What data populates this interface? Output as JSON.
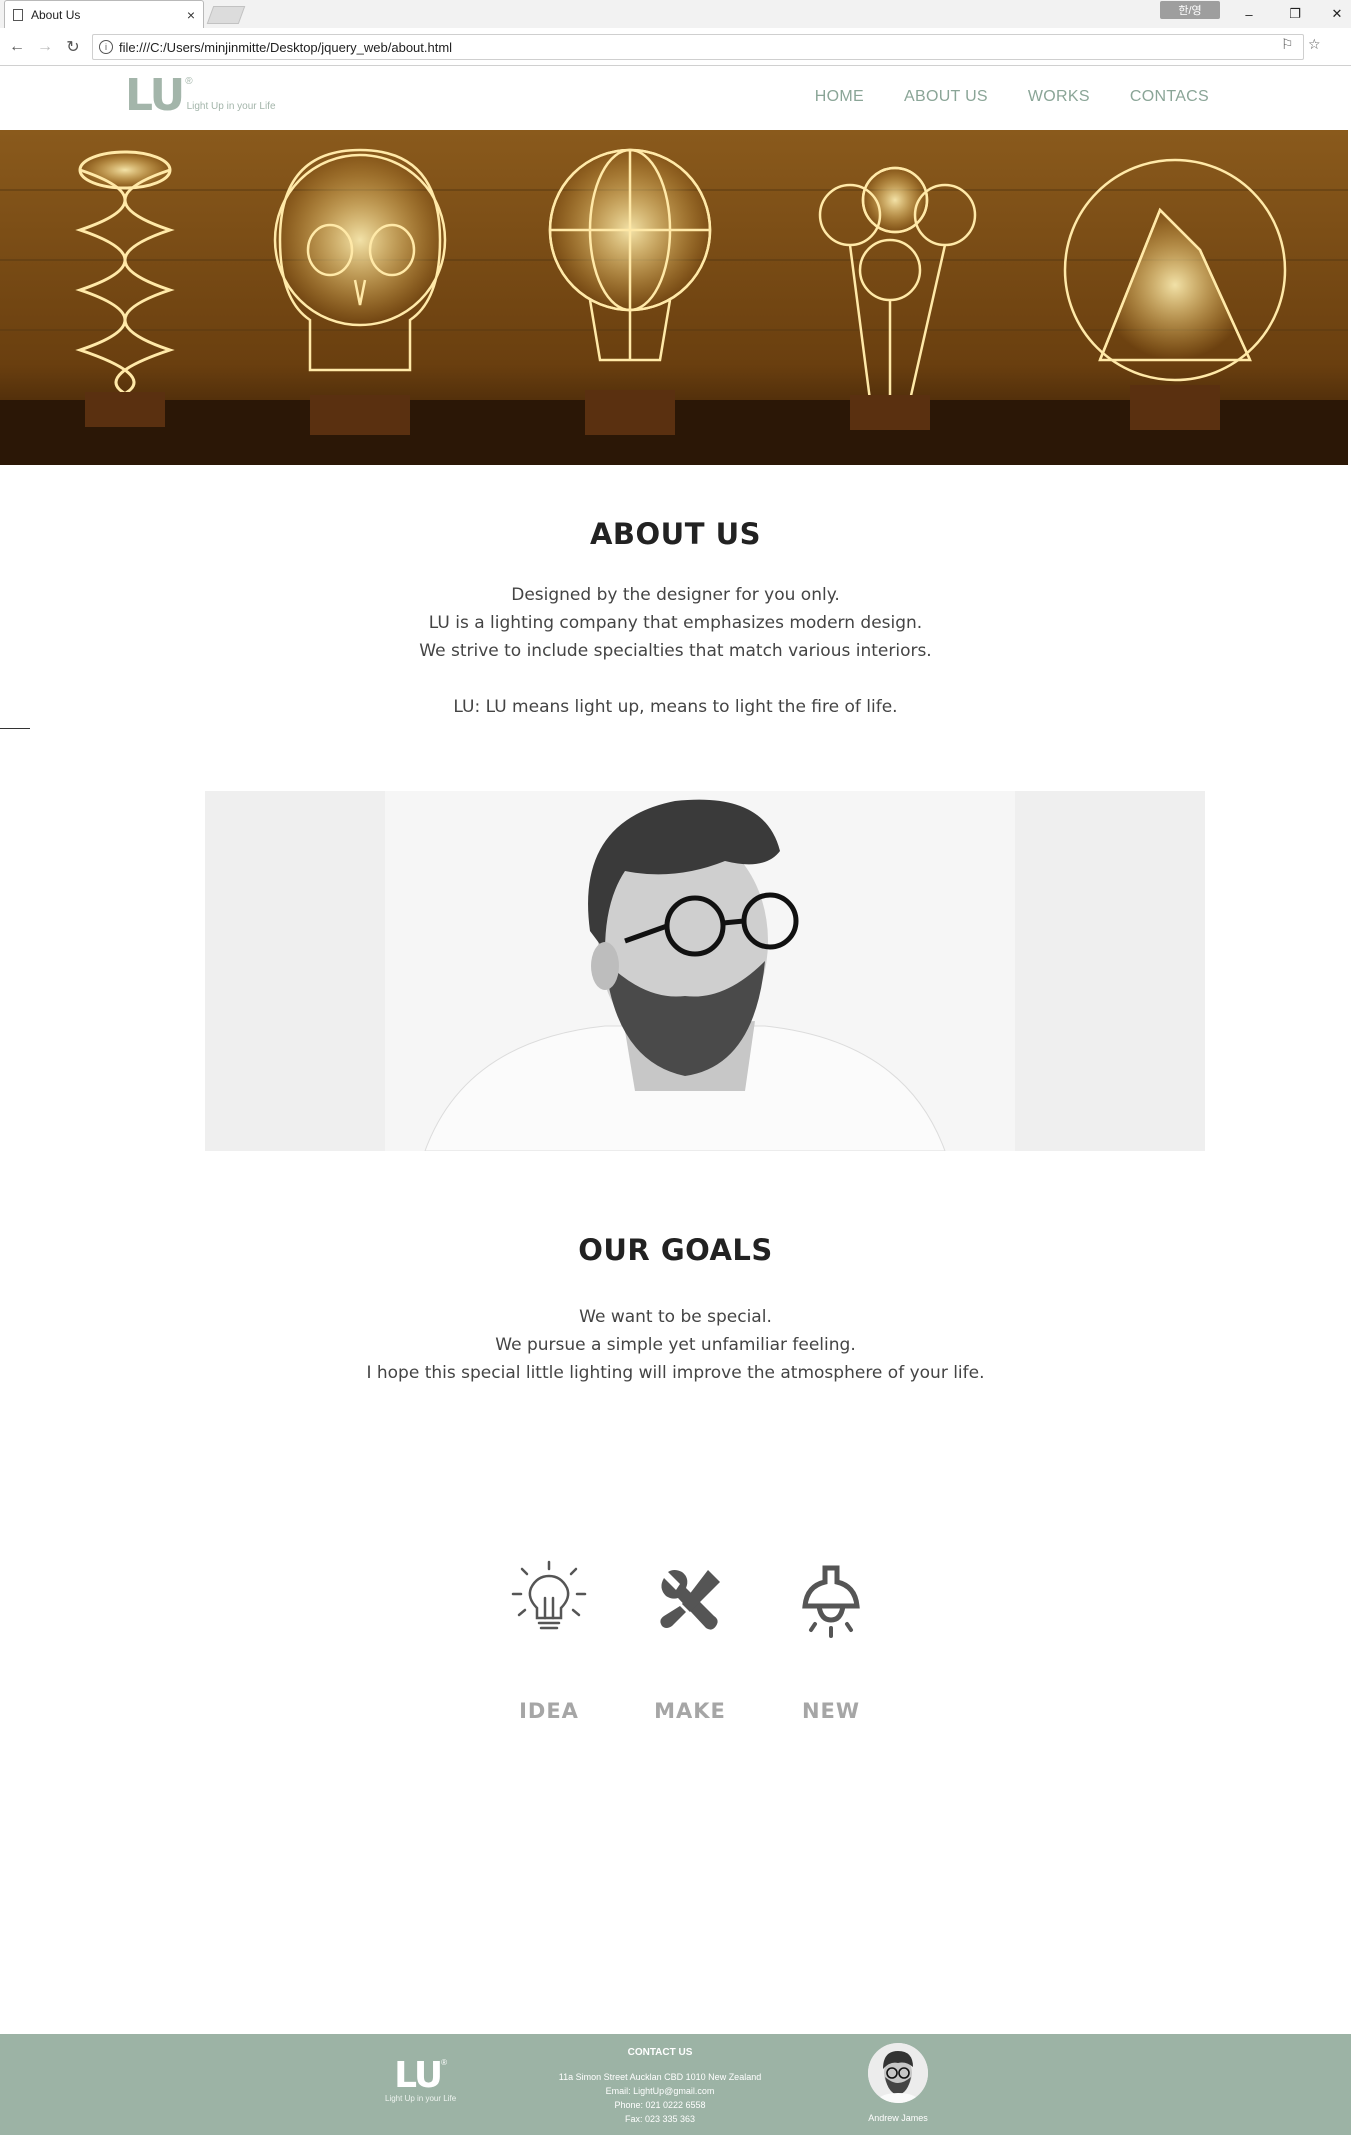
{
  "browser": {
    "tab_title": "About Us",
    "tab_close": "×",
    "url": "file:///C:/Users/minjinmitte/Desktop/jquery_web/about.html",
    "ime_label": "한/영",
    "min": "–",
    "restore": "❐",
    "close": "✕"
  },
  "header": {
    "logo_mark": "LU",
    "logo_reg": "®",
    "logo_tagline": "Light Up in your Life",
    "nav": [
      "HOME",
      "ABOUT US",
      "WORKS",
      "CONTACS"
    ]
  },
  "about": {
    "title": "ABOUT US",
    "lines": [
      "Designed by the designer for you only.",
      "LU is a lighting company that emphasizes modern design.",
      "We strive to include specialties that match various interiors.",
      "LU: LU means light up, means to light the fire of life."
    ]
  },
  "goals": {
    "title": "OUR GOALS",
    "lines": [
      "We want to be special.",
      "We pursue a simple yet unfamiliar feeling.",
      "I hope this special little lighting will improve the atmosphere of your life."
    ]
  },
  "features": [
    {
      "label": "IDEA",
      "icon": "lightbulb-icon"
    },
    {
      "label": "MAKE",
      "icon": "tools-icon"
    },
    {
      "label": "NEW",
      "icon": "pendant-lamp-icon"
    }
  ],
  "footer": {
    "logo_mark": "LU",
    "logo_reg": "®",
    "logo_tagline": "Light Up in your Life",
    "contact_title": "CONTACT US",
    "address": "11a Simon Street Aucklan CBD 1010 New Zealand",
    "email": "Email: LightUp@gmail.com",
    "phone": "Phone: 021 0222 6558",
    "fax": "Fax: 023 335 363",
    "person_name": "Andrew James"
  }
}
